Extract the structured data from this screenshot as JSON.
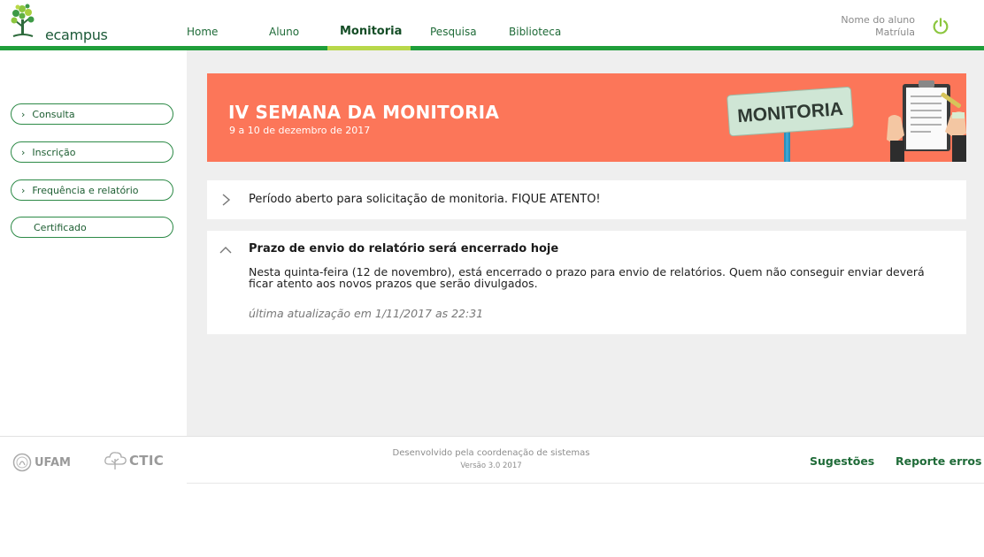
{
  "app": {
    "logo_text": "ecampus"
  },
  "nav": {
    "items": [
      "Home",
      "Aluno",
      "Monitoria",
      "Pesquisa",
      "Biblioteca"
    ],
    "active": "Monitoria"
  },
  "user": {
    "name": "Nome do aluno",
    "matricula": "Matrı́ula"
  },
  "sidebar": {
    "items": [
      {
        "label": "Consulta",
        "icon": "chevron-right-icon"
      },
      {
        "label": "Inscrição",
        "icon": "chevron-right-icon"
      },
      {
        "label": "Frequência e relatório",
        "icon": "chevron-right-icon"
      },
      {
        "label": "Certificado"
      }
    ]
  },
  "banner": {
    "title": "IV SEMANA DA MONITORIA",
    "subtitle": "9 a 10 de dezembro de 2017",
    "sign_text": "MONITORIA"
  },
  "notices": [
    {
      "title": "Período aberto para solicitação de monitoria. FIQUE ATENTO!",
      "expanded": false
    },
    {
      "title": "Prazo de envio do relatório será encerrado hoje",
      "expanded": true,
      "body": "Nesta quinta-feira (12 de novembro), está encerrado o prazo para envio de relatórios. Quem não conseguir enviar deverá ficar atento aos novos prazos que serão divulgados.",
      "updated": "última atualização em 1/11/2017 as  22:31"
    }
  ],
  "footer": {
    "ufam": "UFAM",
    "ctic": "CTIC",
    "developed": "Desenvolvido pela coordenação de sistemas",
    "version": "Versão 3.0 2017",
    "suggestions": "Sugestões",
    "report": "Reporte erros"
  },
  "colors": {
    "brand_green": "#1f9e3a",
    "active_tab": "#b8d84a",
    "banner": "#fc7659",
    "power_icon": "#8cc63f"
  }
}
